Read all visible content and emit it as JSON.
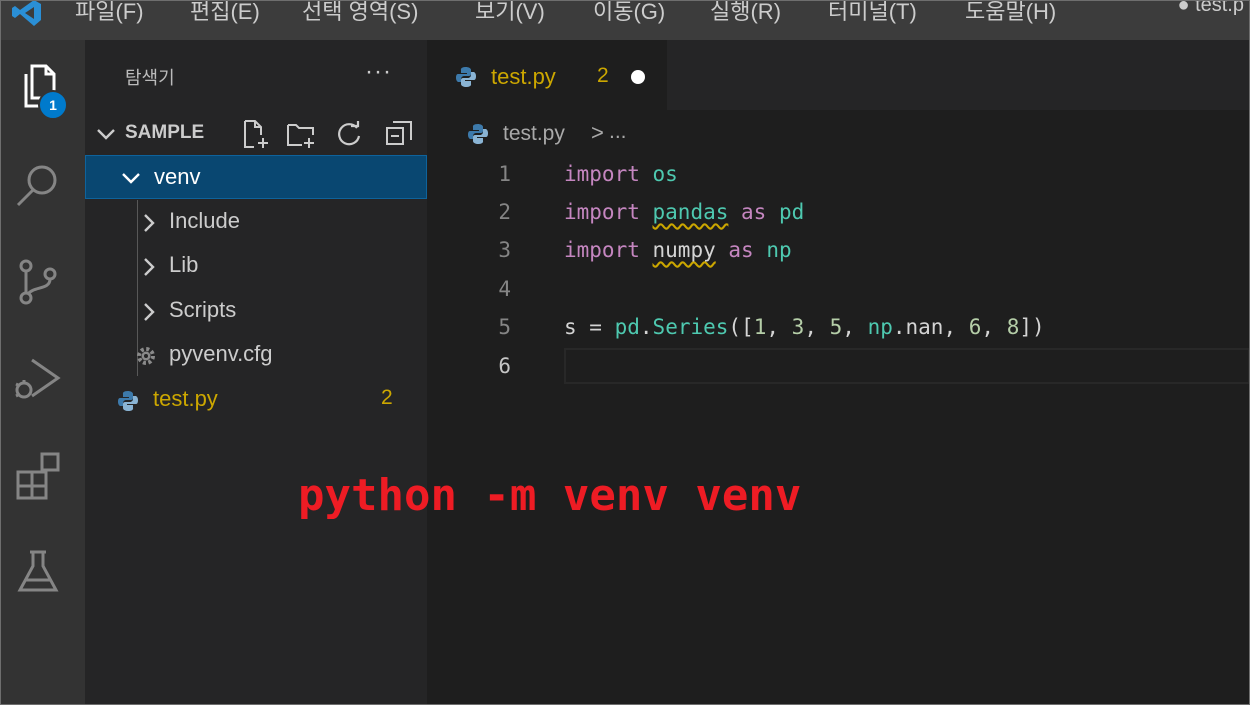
{
  "titlebar": {
    "menu": [
      "파일(F)",
      "편집(E)",
      "선택 영역(S)",
      "보기(V)",
      "이동(G)",
      "실행(R)",
      "터미널(T)",
      "도움말(H)"
    ],
    "window_title": "● test.p"
  },
  "activitybar": {
    "explorer_badge": "1",
    "icons": [
      "files-icon",
      "search-icon",
      "source-control-icon",
      "run-debug-icon",
      "extensions-icon",
      "testing-icon"
    ]
  },
  "sidebar": {
    "title": "탐색기",
    "more": "···",
    "section": "SAMPLE",
    "tree": [
      {
        "label": "venv",
        "kind": "folder",
        "expanded": true,
        "selected": true
      },
      {
        "label": "Include",
        "kind": "folder",
        "expanded": false
      },
      {
        "label": "Lib",
        "kind": "folder",
        "expanded": false
      },
      {
        "label": "Scripts",
        "kind": "folder",
        "expanded": false
      },
      {
        "label": "pyvenv.cfg",
        "kind": "config-file"
      },
      {
        "label": "test.py",
        "kind": "python-file",
        "problems": "2"
      }
    ]
  },
  "editor": {
    "tab": {
      "label": "test.py",
      "problems": "2",
      "modified": true
    },
    "breadcrumb": {
      "file": "test.py",
      "separator": ">",
      "more": "..."
    },
    "line_numbers": [
      "1",
      "2",
      "3",
      "4",
      "5",
      "6"
    ],
    "lines": [
      [
        {
          "t": "import",
          "c": "kw"
        },
        {
          "t": " ",
          "c": "plain"
        },
        {
          "t": "os",
          "c": "mod"
        }
      ],
      [
        {
          "t": "import",
          "c": "kw"
        },
        {
          "t": " ",
          "c": "plain"
        },
        {
          "t": "pandas",
          "c": "mod squig"
        },
        {
          "t": " ",
          "c": "plain"
        },
        {
          "t": "as",
          "c": "kw"
        },
        {
          "t": " ",
          "c": "plain"
        },
        {
          "t": "pd",
          "c": "mod"
        }
      ],
      [
        {
          "t": "import",
          "c": "kw"
        },
        {
          "t": " ",
          "c": "plain"
        },
        {
          "t": "numpy",
          "c": "plain squig"
        },
        {
          "t": " ",
          "c": "plain"
        },
        {
          "t": "as",
          "c": "kw"
        },
        {
          "t": " ",
          "c": "plain"
        },
        {
          "t": "np",
          "c": "mod"
        }
      ],
      [],
      [
        {
          "t": "s",
          "c": "plain"
        },
        {
          "t": " = ",
          "c": "plain"
        },
        {
          "t": "pd",
          "c": "mod"
        },
        {
          "t": ".",
          "c": "plain"
        },
        {
          "t": "Series",
          "c": "mod"
        },
        {
          "t": "([",
          "c": "plain"
        },
        {
          "t": "1",
          "c": "num"
        },
        {
          "t": ", ",
          "c": "plain"
        },
        {
          "t": "3",
          "c": "num"
        },
        {
          "t": ", ",
          "c": "plain"
        },
        {
          "t": "5",
          "c": "num"
        },
        {
          "t": ", ",
          "c": "plain"
        },
        {
          "t": "np",
          "c": "mod"
        },
        {
          "t": ".",
          "c": "plain"
        },
        {
          "t": "nan",
          "c": "plain"
        },
        {
          "t": ", ",
          "c": "plain"
        },
        {
          "t": "6",
          "c": "num"
        },
        {
          "t": ", ",
          "c": "plain"
        },
        {
          "t": "8",
          "c": "num"
        },
        {
          "t": "])",
          "c": "plain"
        }
      ],
      []
    ]
  },
  "annotation": "python -m venv venv",
  "colors": {
    "accent": "#007acc",
    "warning": "#cca700",
    "annotation": "#ee1c24",
    "selection": "#094771"
  }
}
